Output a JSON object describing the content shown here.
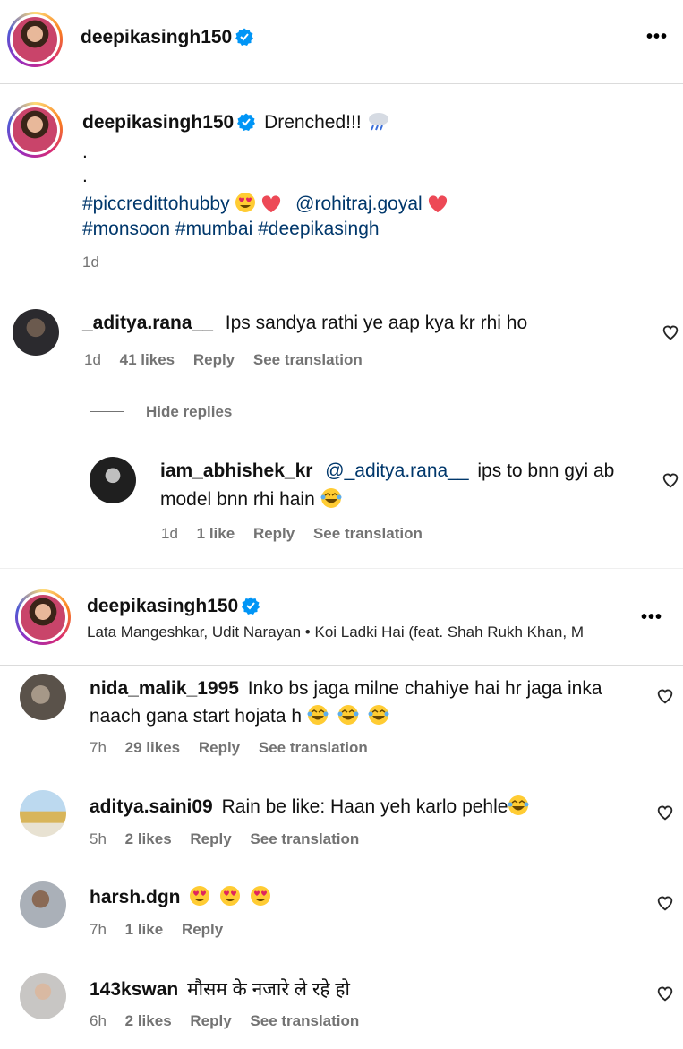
{
  "header": {
    "username": "deepikasingh150",
    "more_label": "•••"
  },
  "caption": {
    "username": "deepikasingh150",
    "text": "Drenched!!!",
    "dot1": ".",
    "dot2": ".",
    "tag1": "#piccredittohubby",
    "mention": "@rohitraj.goyal",
    "tags2": "#monsoon #mumbai #deepikasingh",
    "time": "1d"
  },
  "comment1": {
    "username": "_aditya.rana__",
    "text": "Ips sandya rathi ye aap kya kr rhi ho",
    "time": "1d",
    "likes": "41 likes",
    "reply": "Reply",
    "translate": "See translation",
    "hide_replies": "Hide replies"
  },
  "reply1": {
    "username": "iam_abhishek_kr",
    "mention": "@_aditya.rana__",
    "text_line1": "ips to bnn gyi ab",
    "text_line2": "model bnn rhi hain",
    "time": "1d",
    "likes": "1 like",
    "reply": "Reply",
    "translate": "See translation"
  },
  "header2": {
    "username": "deepikasingh150",
    "music": "Lata Mangeshkar, Udit Narayan • Koi Ladki Hai (feat. Shah Rukh Khan, M",
    "more_label": "•••"
  },
  "comments": [
    {
      "username": "nida_malik_1995",
      "text_line1": "Inko bs jaga milne chahiye hai hr jaga inka",
      "text_line2": "naach gana start hojata h",
      "time": "7h",
      "likes": "29 likes",
      "reply": "Reply",
      "translate": "See translation"
    },
    {
      "username": "aditya.saini09",
      "text": "Rain be like: Haan yeh karlo pehle",
      "time": "5h",
      "likes": "2 likes",
      "reply": "Reply",
      "translate": "See translation"
    },
    {
      "username": "harsh.dgn",
      "text": "",
      "time": "7h",
      "likes": "1 like",
      "reply": "Reply"
    },
    {
      "username": "143kswan",
      "text": "मौसम के नजारे ले रहे हो",
      "time": "6h",
      "likes": "2 likes",
      "reply": "Reply",
      "translate": "See translation"
    }
  ],
  "colors": {
    "link": "#00376b",
    "meta": "#737373",
    "verified": "#0095f6",
    "heart_red": "#ed4956"
  }
}
